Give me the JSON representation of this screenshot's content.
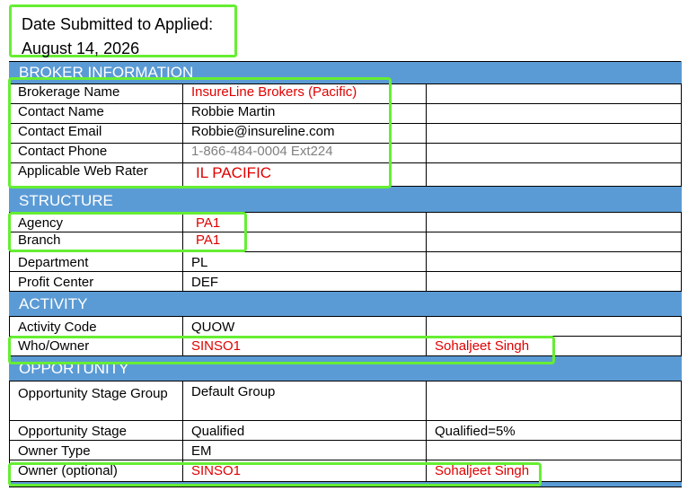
{
  "title": {
    "line1": "Date Submitted to Applied:",
    "line2": "August 14, 2026"
  },
  "sections": {
    "broker": {
      "header": "BROKER INFORMATION",
      "rows": [
        {
          "label": "Brokerage Name",
          "value": "InsureLine Brokers (Pacific)",
          "extra": ""
        },
        {
          "label": "Contact Name",
          "value": "Robbie Martin",
          "extra": ""
        },
        {
          "label": "Contact Email",
          "value": "Robbie@insureline.com",
          "extra": ""
        },
        {
          "label": "Contact Phone",
          "value": "1-866-484-0004 Ext224",
          "extra": ""
        },
        {
          "label": "Applicable Web Rater",
          "value": "IL PACIFIC",
          "extra": ""
        }
      ]
    },
    "structure": {
      "header": "STRUCTURE",
      "rows": [
        {
          "label": "Agency",
          "value": "PA1",
          "extra": ""
        },
        {
          "label": "Branch",
          "value": "PA1",
          "extra": ""
        },
        {
          "label": "Department",
          "value": "PL",
          "extra": ""
        },
        {
          "label": "Profit Center",
          "value": "DEF",
          "extra": ""
        }
      ]
    },
    "activity": {
      "header": "ACTIVITY",
      "rows": [
        {
          "label": "Activity Code",
          "value": "QUOW",
          "extra": ""
        },
        {
          "label": "Who/Owner",
          "value": "SINSO1",
          "extra": "Sohaljeet Singh"
        }
      ]
    },
    "opportunity": {
      "header": "OPPORTUNITY",
      "rows": [
        {
          "label": "Opportunity Stage Group",
          "value": "Default Group",
          "extra": ""
        },
        {
          "label": "Opportunity Stage",
          "value": "Qualified",
          "extra": "Qualified=5%"
        },
        {
          "label": "Owner Type",
          "value": "EM",
          "extra": ""
        },
        {
          "label": "Owner (optional)",
          "value": "SINSO1",
          "extra": "Sohaljeet Singh"
        }
      ]
    }
  },
  "colors": {
    "section_header": "#5b9bd5",
    "highlight": "#66ee33",
    "red_text": "#e00000",
    "gray_text": "#808080"
  }
}
